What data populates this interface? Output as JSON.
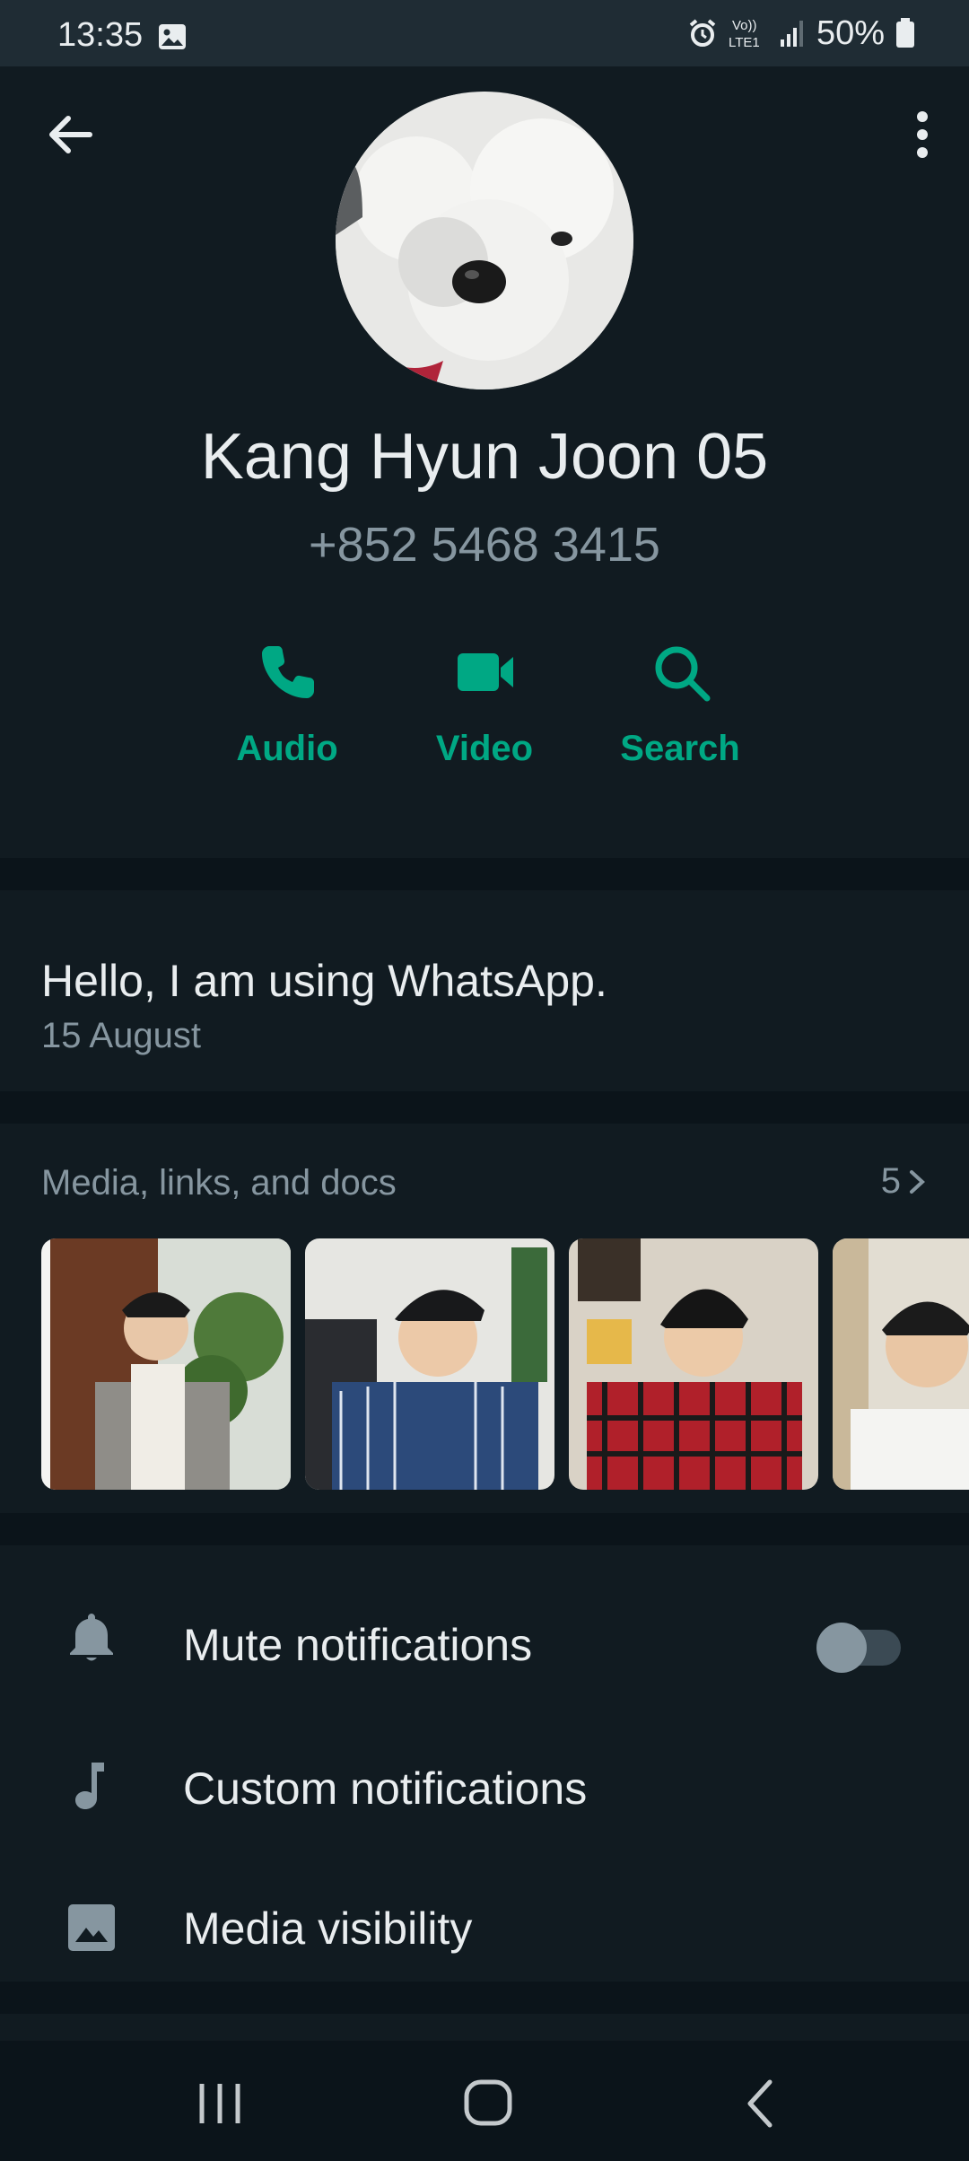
{
  "status_bar": {
    "time": "13:35",
    "battery_percent": "50%",
    "network_label_top": "Vo))",
    "network_label_bottom": "LTE1"
  },
  "contact": {
    "name": "Kang Hyun Joon 05",
    "phone": "+852 5468 3415"
  },
  "actions": [
    {
      "label": "Audio",
      "icon": "phone-icon"
    },
    {
      "label": "Video",
      "icon": "video-icon"
    },
    {
      "label": "Search",
      "icon": "search-icon"
    }
  ],
  "about": {
    "text": "Hello, I am using WhatsApp.",
    "date": "15 August"
  },
  "media": {
    "title": "Media, links, and docs",
    "count": "5"
  },
  "settings": [
    {
      "label": "Mute notifications",
      "icon": "bell-icon",
      "toggle": false
    },
    {
      "label": "Custom notifications",
      "icon": "music-note-icon"
    },
    {
      "label": "Media visibility",
      "icon": "image-icon"
    }
  ],
  "colors": {
    "accent": "#00a884",
    "background": "#111b21",
    "divider": "#0b141a",
    "secondary_text": "#8696a0"
  }
}
